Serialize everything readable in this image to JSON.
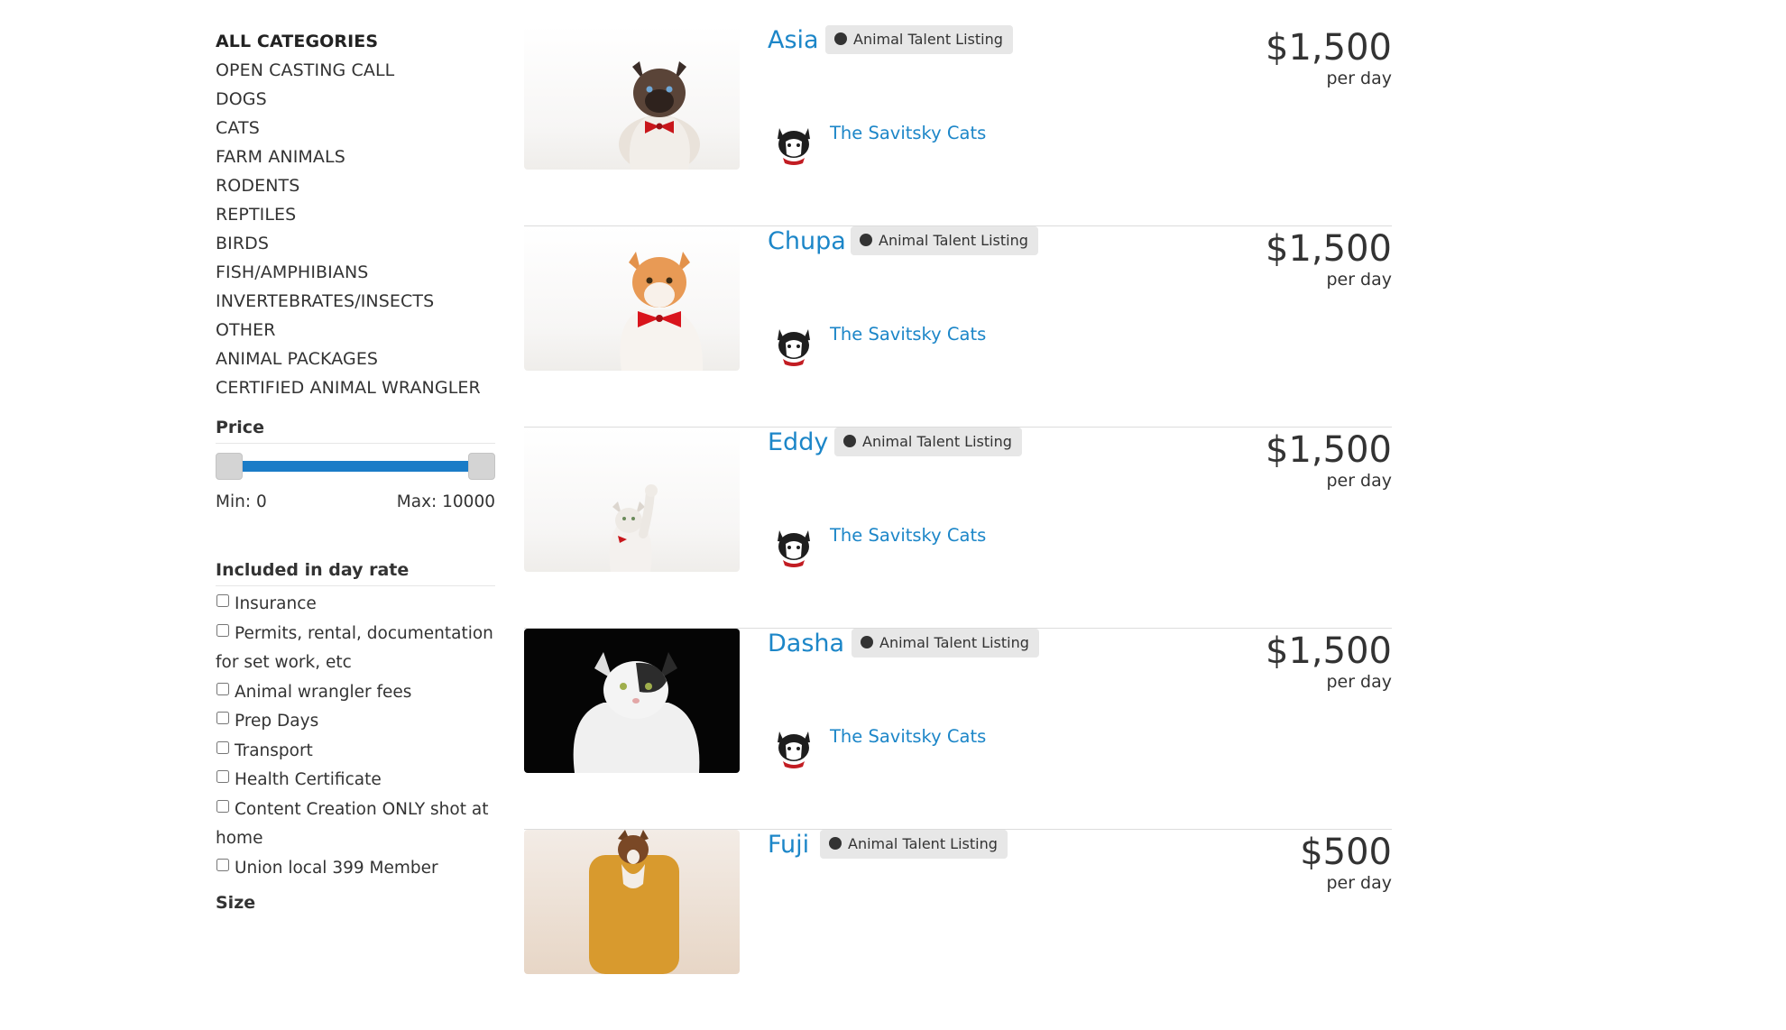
{
  "categories": [
    {
      "label": "ALL CATEGORIES",
      "active": true
    },
    {
      "label": "OPEN CASTING CALL"
    },
    {
      "label": "DOGS"
    },
    {
      "label": "CATS"
    },
    {
      "label": "FARM ANIMALS"
    },
    {
      "label": "RODENTS"
    },
    {
      "label": "REPTILES"
    },
    {
      "label": "BIRDS"
    },
    {
      "label": "FISH/AMPHIBIANS"
    },
    {
      "label": "INVERTEBRATES/INSECTS"
    },
    {
      "label": "OTHER"
    },
    {
      "label": "ANIMAL PACKAGES"
    },
    {
      "label": "CERTIFIED ANIMAL WRANGLER"
    }
  ],
  "price_filter": {
    "title": "Price",
    "min_label": "Min: 0",
    "max_label": "Max: 10000",
    "accent": "#1a7cc7"
  },
  "included_filter": {
    "title": "Included in day rate",
    "options": [
      "Insurance",
      "Permits, rental, documentation for set work, etc",
      "Animal wrangler fees",
      "Prep Days",
      "Transport",
      "Health Certificate",
      "Content Creation ONLY shot at home",
      "Union local 399 Member"
    ]
  },
  "size_filter": {
    "title": "Size"
  },
  "listings": [
    {
      "name": "Asia",
      "badge": "Animal Talent Listing",
      "owner": "The Savitsky Cats",
      "price": "$1,500",
      "unit": "per day",
      "image": "cat-photo"
    },
    {
      "name": "Chupa",
      "badge": "Animal Talent Listing",
      "owner": "The Savitsky Cats",
      "price": "$1,500",
      "unit": "per day",
      "image": "cat-photo"
    },
    {
      "name": "Eddy",
      "badge": "Animal Talent Listing",
      "owner": "The Savitsky Cats",
      "price": "$1,500",
      "unit": "per day",
      "image": "cat-photo"
    },
    {
      "name": "Dasha",
      "badge": "Animal Talent Listing",
      "owner": "The Savitsky Cats",
      "price": "$1,500",
      "unit": "per day",
      "image": "cat-photo"
    },
    {
      "name": "Fuji",
      "badge": "Animal Talent Listing",
      "owner": "",
      "price": "$500",
      "unit": "per day",
      "image": "dog-photo"
    }
  ],
  "colors": {
    "link": "#1c86c8",
    "text": "#333333",
    "badge_bg": "#e7e7e7"
  }
}
